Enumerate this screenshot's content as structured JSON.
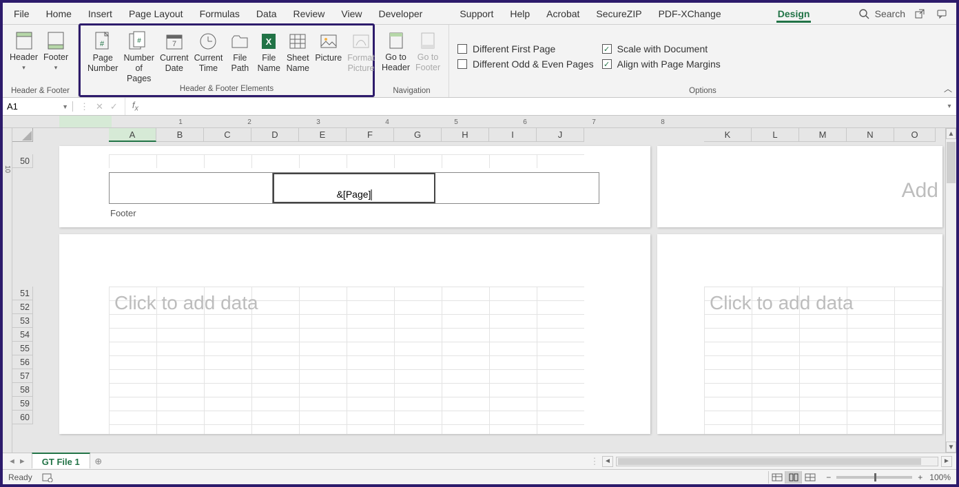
{
  "tabbar": {
    "tabs_left": [
      "File",
      "Home",
      "Insert",
      "Page Layout",
      "Formulas",
      "Data",
      "Review",
      "View",
      "Developer"
    ],
    "tabs_right": [
      "Support",
      "Help",
      "Acrobat",
      "SecureZIP",
      "PDF-XChange"
    ],
    "active_tab": "Design",
    "search_label": "Search"
  },
  "ribbon": {
    "group_header_footer": {
      "label": "Header & Footer",
      "header_btn": "Header",
      "footer_btn": "Footer"
    },
    "group_elements": {
      "label": "Header & Footer Elements",
      "page_number": "Page Number",
      "num_pages": "Number of Pages",
      "current_date": "Current Date",
      "current_time": "Current Time",
      "file_path": "File Path",
      "file_name": "File Name",
      "sheet_name": "Sheet Name",
      "picture": "Picture",
      "format_picture": "Format Picture"
    },
    "group_navigation": {
      "label": "Navigation",
      "goto_header": "Go to Header",
      "goto_footer": "Go to Footer"
    },
    "group_options": {
      "label": "Options",
      "diff_first": "Different First Page",
      "diff_odd_even": "Different Odd & Even Pages",
      "scale_doc": "Scale with Document",
      "align_margins": "Align with Page Margins",
      "diff_first_checked": false,
      "diff_odd_even_checked": false,
      "scale_doc_checked": true,
      "align_margins_checked": true
    }
  },
  "formula_bar": {
    "name_box": "A1",
    "formula": ""
  },
  "sheet": {
    "columns_left": [
      "A",
      "B",
      "C",
      "D",
      "E",
      "F",
      "G",
      "H",
      "I",
      "J"
    ],
    "columns_right": [
      "K",
      "L",
      "M",
      "N",
      "O"
    ],
    "row_first_block": [
      "50"
    ],
    "rows_second_block": [
      "51",
      "52",
      "53",
      "54",
      "55",
      "56",
      "57",
      "58",
      "59",
      "60"
    ],
    "footer_code": "&[Page]",
    "footer_label": "Footer",
    "placeholder_left": "Click to add data",
    "placeholder_right": "Click to add data",
    "add_text": "Add",
    "ruler_marks": [
      1,
      2,
      3,
      4,
      5,
      6,
      7,
      8
    ]
  },
  "sheet_tab": {
    "name": "GT File 1"
  },
  "statusbar": {
    "state": "Ready",
    "zoom": "100%"
  }
}
